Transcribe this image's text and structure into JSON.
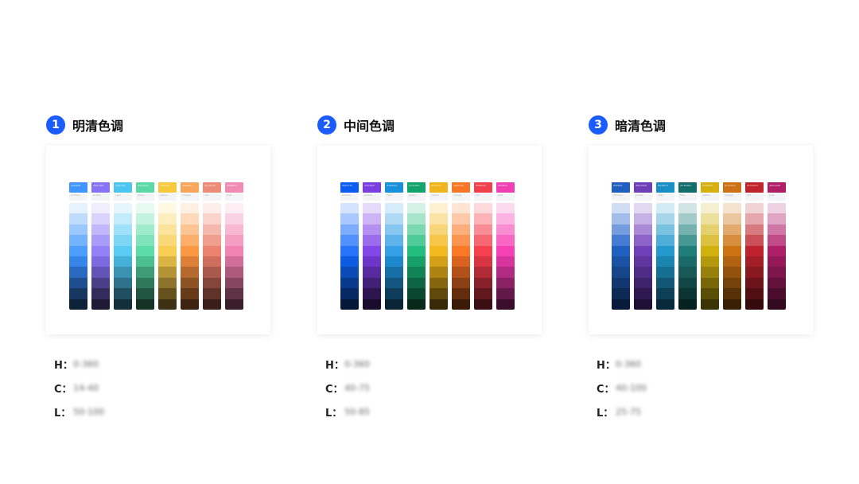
{
  "groups": [
    {
      "number": "1",
      "title": "明清色调",
      "meta": [
        {
          "label": "H：",
          "value": "0-360"
        },
        {
          "label": "C：",
          "value": "14-40"
        },
        {
          "label": "L：",
          "value": "50-100"
        }
      ],
      "columns": [
        {
          "head": "#4096ff",
          "sub": "primary",
          "swatches": [
            "#e6f2ff",
            "#bfdcff",
            "#9ac8ff",
            "#74b3ff",
            "#4e9eff",
            "#3586e8",
            "#2969be",
            "#1e4e8f",
            "#153760",
            "#0d2138"
          ]
        },
        {
          "head": "#8674f5",
          "sub": "purple",
          "swatches": [
            "#efedfe",
            "#d9d3fd",
            "#c1b8fb",
            "#a99cf9",
            "#9281f7",
            "#7b6ae0",
            "#6453b6",
            "#4b3e88",
            "#332b5c",
            "#1e1a35"
          ]
        },
        {
          "head": "#4ec5f1",
          "sub": "cyan",
          "swatches": [
            "#e5f7fd",
            "#c2ecfb",
            "#9fe1f8",
            "#7dd6f5",
            "#5acbf2",
            "#45b1d8",
            "#3a92b2",
            "#2d718a",
            "#1f4f60",
            "#132f39"
          ]
        },
        {
          "head": "#5ad8a6",
          "sub": "green",
          "swatches": [
            "#e6faf1",
            "#c3f2df",
            "#a1ebcd",
            "#7fe4bb",
            "#5cdca8",
            "#4bbf90",
            "#3d9c76",
            "#2f795b",
            "#215640",
            "#143326"
          ]
        },
        {
          "head": "#f6c93f",
          "sub": "yellow",
          "swatches": [
            "#fff8e3",
            "#fdeebf",
            "#fce39b",
            "#fbd877",
            "#f9ce53",
            "#dcb443",
            "#b49337",
            "#8c722a",
            "#64511e",
            "#3c3112"
          ]
        },
        {
          "head": "#f8a65c",
          "sub": "orange",
          "swatches": [
            "#fff0e4",
            "#fedabb",
            "#fdc493",
            "#fcae6b",
            "#fb9843",
            "#dd8139",
            "#b5692f",
            "#8d5224",
            "#653b1a",
            "#3d2310"
          ]
        },
        {
          "head": "#ec8b78",
          "sub": "red",
          "swatches": [
            "#fdeeeb",
            "#f9d3cc",
            "#f5b8ad",
            "#f19d8e",
            "#ed826f",
            "#d06e5d",
            "#aa5a4c",
            "#84463b",
            "#5f322a",
            "#391e19"
          ]
        },
        {
          "head": "#f08bb4",
          "sub": "pink",
          "swatches": [
            "#fdeef4",
            "#fad3e3",
            "#f7b9d2",
            "#f49ec2",
            "#f184b1",
            "#d36e98",
            "#ad5a7d",
            "#864662",
            "#603246",
            "#3a1e2a"
          ]
        }
      ]
    },
    {
      "number": "2",
      "title": "中间色调",
      "meta": [
        {
          "label": "H：",
          "value": "0-360"
        },
        {
          "label": "C：",
          "value": "40-75"
        },
        {
          "label": "L：",
          "value": "50-85"
        }
      ],
      "columns": [
        {
          "head": "#0b5cf0",
          "sub": "primary",
          "swatches": [
            "#d4e4ff",
            "#a9c8ff",
            "#7eacfd",
            "#5290fb",
            "#2774f9",
            "#0b5ce0",
            "#0a4bb6",
            "#083a8c",
            "#062963",
            "#041939"
          ]
        },
        {
          "head": "#7b3fe0",
          "sub": "purple",
          "swatches": [
            "#e6dafa",
            "#cdb5f5",
            "#b491f0",
            "#9b6ceb",
            "#8247e6",
            "#6d35c8",
            "#572aa0",
            "#422078",
            "#2d1650",
            "#190c2d"
          ]
        },
        {
          "head": "#1890dc",
          "sub": "cyan",
          "swatches": [
            "#d7ecfa",
            "#afd9f5",
            "#87c6f0",
            "#5fb3eb",
            "#379fe6",
            "#1d88cb",
            "#186fa6",
            "#135680",
            "#0d3d5b",
            "#082435"
          ]
        },
        {
          "head": "#12a46c",
          "sub": "green",
          "swatches": [
            "#d3f2e5",
            "#a7e5cb",
            "#7bd8b1",
            "#4fcb97",
            "#23be7d",
            "#17a168",
            "#128356",
            "#0e6543",
            "#0a4730",
            "#06291c"
          ]
        },
        {
          "head": "#f1b51c",
          "sub": "yellow",
          "swatches": [
            "#fdf1d2",
            "#fbe3a5",
            "#f8d578",
            "#f6c74b",
            "#f3b91e",
            "#d4a017",
            "#ad8313",
            "#86650f",
            "#5f480a",
            "#382a06"
          ]
        },
        {
          "head": "#f87726",
          "sub": "orange",
          "swatches": [
            "#fee4d3",
            "#fdc9a8",
            "#fcae7c",
            "#fb9351",
            "#fa7826",
            "#db6320",
            "#b3511a",
            "#8b3f14",
            "#632d0e",
            "#3b1b08"
          ]
        },
        {
          "head": "#f0404d",
          "sub": "red",
          "swatches": [
            "#fdd9dc",
            "#fbb3b8",
            "#f98d95",
            "#f76771",
            "#f5414e",
            "#d73542",
            "#b02b36",
            "#89212a",
            "#62181e",
            "#3a0e12"
          ]
        },
        {
          "head": "#f03fb3",
          "sub": "pink",
          "swatches": [
            "#fdd9f0",
            "#fbb3e1",
            "#f98dd2",
            "#f767c3",
            "#f541b4",
            "#d7359d",
            "#b02b81",
            "#892164",
            "#621848",
            "#3a0e2b"
          ]
        }
      ]
    },
    {
      "number": "3",
      "title": "暗清色调",
      "meta": [
        {
          "label": "H：",
          "value": "0-360"
        },
        {
          "label": "C：",
          "value": "40-100"
        },
        {
          "label": "L：",
          "value": "25-75"
        }
      ],
      "columns": [
        {
          "head": "#1f5fbf",
          "sub": "primary",
          "swatches": [
            "#d0def5",
            "#a2bdea",
            "#749cdf",
            "#467bd4",
            "#1f5fbf",
            "#1b52a6",
            "#17458b",
            "#123770",
            "#0d2955",
            "#081b3a"
          ]
        },
        {
          "head": "#6e3db8",
          "sub": "purple",
          "swatches": [
            "#e2d8f1",
            "#c5b1e3",
            "#a98ad5",
            "#8d63c7",
            "#7040b9",
            "#5f36a0",
            "#4f2d86",
            "#3f246b",
            "#2e1a50",
            "#1e1135"
          ]
        },
        {
          "head": "#1a8fc4",
          "sub": "cyan",
          "swatches": [
            "#d3ebf5",
            "#a7d6eb",
            "#7bc2e1",
            "#4fadd7",
            "#2399cd",
            "#1c84b1",
            "#176e93",
            "#125775",
            "#0d4057",
            "#082939"
          ]
        },
        {
          "head": "#136d6a",
          "sub": "teal",
          "swatches": [
            "#d1e5e4",
            "#a3cbc9",
            "#75b1ae",
            "#479793",
            "#1f7d79",
            "#1a6b68",
            "#165956",
            "#114644",
            "#0c3432",
            "#072120"
          ]
        },
        {
          "head": "#d6b00c",
          "sub": "yellow",
          "swatches": [
            "#f6efcf",
            "#ede09f",
            "#e4d06f",
            "#dbc13f",
            "#d2b10f",
            "#b5990d",
            "#97800b",
            "#786609",
            "#5a4d07",
            "#3c3305"
          ]
        },
        {
          "head": "#cd7214",
          "sub": "orange",
          "swatches": [
            "#f5e3cf",
            "#ebc79f",
            "#e1ab6f",
            "#d78f3f",
            "#cd7314",
            "#b16311",
            "#93530e",
            "#75420b",
            "#573108",
            "#392005"
          ]
        },
        {
          "head": "#c0252d",
          "sub": "red",
          "swatches": [
            "#f2d3d5",
            "#e5a7ab",
            "#d87b81",
            "#cb4f57",
            "#be232d",
            "#a31e27",
            "#881921",
            "#6c141a",
            "#510f14",
            "#360a0d"
          ]
        },
        {
          "head": "#b01e68",
          "sub": "pink",
          "swatches": [
            "#efd2e1",
            "#dfa5c3",
            "#cf78a5",
            "#bf4b87",
            "#af1e69",
            "#961a5a",
            "#7d164b",
            "#64113c",
            "#4b0d2d",
            "#32091e"
          ]
        }
      ]
    }
  ]
}
